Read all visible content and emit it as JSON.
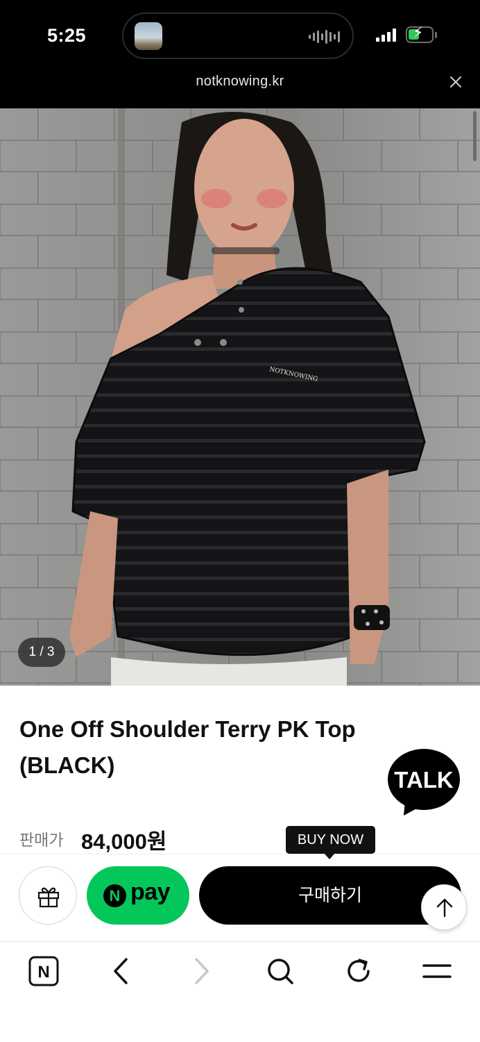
{
  "status_bar": {
    "time": "5:25"
  },
  "browser": {
    "url": "notknowing.kr"
  },
  "product": {
    "image_counter": "1 / 3",
    "title": "One Off Shoulder Terry PK Top (BLACK)",
    "price_label": "판매가",
    "price": "84,000원",
    "shirt_logo_text": "NOTKNOWING"
  },
  "kakao_talk": {
    "label": "TALK"
  },
  "purchase_bar": {
    "tooltip": "BUY NOW",
    "npay_n": "N",
    "npay_label": "pay",
    "buy_label": "구매하기"
  },
  "toolbar": {
    "home_letter": "N"
  },
  "colors": {
    "npay_green": "#03c75a",
    "buy_button": "#000000",
    "kakao_bubble": "#000000"
  },
  "icons": {
    "close": "close-icon",
    "gift": "gift-icon",
    "scroll_top": "arrow-up-icon",
    "back": "chevron-left-icon",
    "forward": "chevron-right-icon",
    "search": "search-icon",
    "reload": "reload-icon",
    "menu": "menu-icon"
  }
}
